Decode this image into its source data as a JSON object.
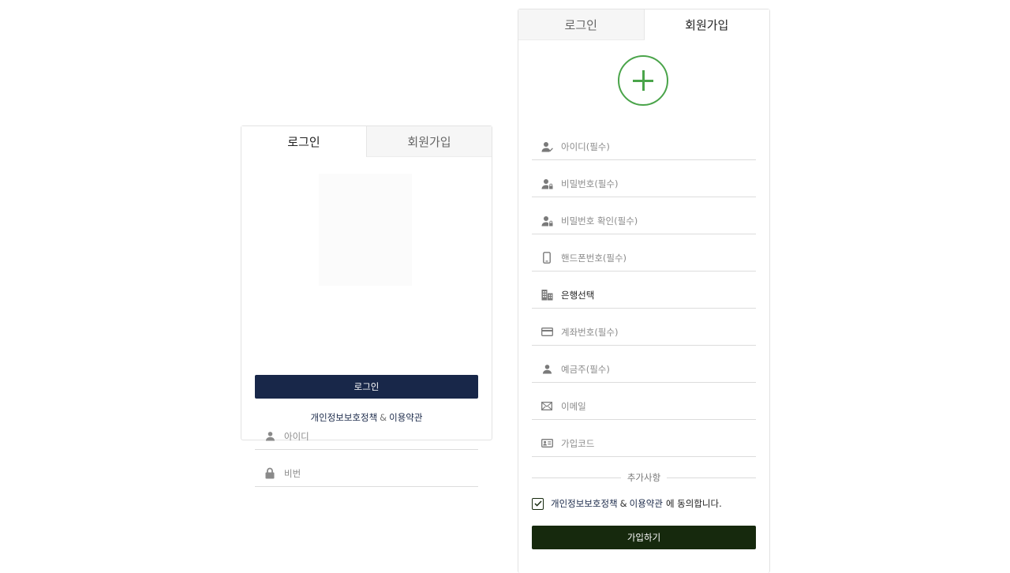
{
  "login_panel": {
    "tabs": [
      "로그인",
      "회원가입"
    ],
    "id_placeholder": "아이디",
    "pw_placeholder": "비번",
    "login_button": "로그인",
    "privacy_link": "개인정보보호정책",
    "amp": "&",
    "terms_link": "이용약관"
  },
  "signup_panel": {
    "tabs": [
      "로그인",
      "회원가입"
    ],
    "fields": [
      {
        "placeholder": "아이디(필수)",
        "icon": "user-check-icon"
      },
      {
        "placeholder": "비밀번호(필수)",
        "icon": "user-lock-icon"
      },
      {
        "placeholder": "비밀번호 확인(필수)",
        "icon": "user-lock-icon"
      },
      {
        "placeholder": "핸드폰번호(필수)",
        "icon": "phone-icon"
      },
      {
        "value": "은행선택",
        "icon": "bank-icon"
      },
      {
        "placeholder": "계좌번호(필수)",
        "icon": "card-icon"
      },
      {
        "placeholder": "예금주(필수)",
        "icon": "user-icon"
      },
      {
        "placeholder": "이메일",
        "icon": "mail-icon"
      },
      {
        "placeholder": "가입코드",
        "icon": "id-card-icon"
      }
    ],
    "extra_label": "추가사항",
    "agree": {
      "privacy_link": "개인정보보호정책",
      "amp": "&",
      "terms_link": "이용약관",
      "tail": "에 동의합니다."
    },
    "signup_button": "가입하기"
  },
  "colors": {
    "login_button": "#182749",
    "signup_button": "#16290d",
    "plus_accent": "#4aa44a"
  }
}
